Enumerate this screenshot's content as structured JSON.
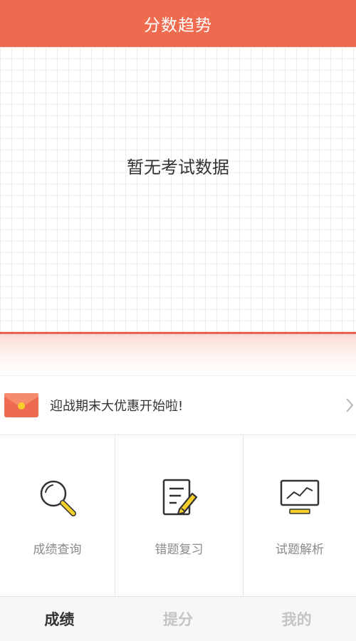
{
  "header": {
    "title": "分数趋势"
  },
  "trend": {
    "empty_message": "暂无考试数据"
  },
  "promo": {
    "text": "迎战期末大优惠开始啦!"
  },
  "features": [
    {
      "label": "成绩查询",
      "icon": "magnifier-icon"
    },
    {
      "label": "错题复习",
      "icon": "notepad-pencil-icon"
    },
    {
      "label": "试题解析",
      "icon": "monitor-chart-icon"
    }
  ],
  "tabs": [
    {
      "label": "成绩",
      "active": true
    },
    {
      "label": "提分",
      "active": false
    },
    {
      "label": "我的",
      "active": false
    }
  ],
  "colors": {
    "brand": "#ef6b50",
    "accent_yellow": "#f7cf2b",
    "icon_stroke": "#333333"
  }
}
